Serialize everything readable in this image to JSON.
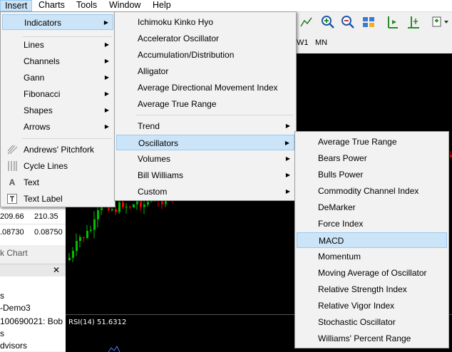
{
  "menubar": {
    "items": [
      "Insert",
      "Charts",
      "Tools",
      "Window",
      "Help"
    ]
  },
  "timeframes": [
    "W1",
    "MN"
  ],
  "quotes": [
    {
      "bid": "209.66",
      "ask": "210.35"
    },
    {
      "bid": ".08730",
      "ask": "0.08750"
    }
  ],
  "left_tab_label": "k Chart",
  "navigator": {
    "lines": [
      "s",
      "-Demo3",
      "100690021: Bob",
      "s",
      "dvisors"
    ]
  },
  "rsi_label": "RSI(14) 51.6312",
  "insert_menu": {
    "items": [
      {
        "label": "Indicators",
        "submenu": true,
        "highlight": true
      },
      {
        "label": "Lines",
        "submenu": true
      },
      {
        "label": "Channels",
        "submenu": true
      },
      {
        "label": "Gann",
        "submenu": true
      },
      {
        "label": "Fibonacci",
        "submenu": true
      },
      {
        "label": "Shapes",
        "submenu": true
      },
      {
        "label": "Arrows",
        "submenu": true
      },
      {
        "label": "Andrews' Pitchfork",
        "icon": "pitchfork-icon"
      },
      {
        "label": "Cycle Lines",
        "icon": "cycle-lines-icon"
      },
      {
        "label": "Text",
        "icon": "text-icon"
      },
      {
        "label": "Text Label",
        "icon": "text-label-icon"
      }
    ]
  },
  "indicators_menu": {
    "items": [
      {
        "label": "Ichimoku Kinko Hyo"
      },
      {
        "label": "Accelerator Oscillator"
      },
      {
        "label": "Accumulation/Distribution"
      },
      {
        "label": "Alligator"
      },
      {
        "label": "Average Directional Movement Index"
      },
      {
        "label": "Average True Range"
      },
      {
        "label": "Trend",
        "submenu": true
      },
      {
        "label": "Oscillators",
        "submenu": true,
        "highlight": true
      },
      {
        "label": "Volumes",
        "submenu": true
      },
      {
        "label": "Bill Williams",
        "submenu": true
      },
      {
        "label": "Custom",
        "submenu": true
      }
    ]
  },
  "oscillators_menu": {
    "items": [
      {
        "label": "Average True Range"
      },
      {
        "label": "Bears Power"
      },
      {
        "label": "Bulls Power"
      },
      {
        "label": "Commodity Channel Index"
      },
      {
        "label": "DeMarker"
      },
      {
        "label": "Force Index"
      },
      {
        "label": "MACD",
        "highlight": true
      },
      {
        "label": "Momentum"
      },
      {
        "label": "Moving Average of Oscillator"
      },
      {
        "label": "Relative Strength Index"
      },
      {
        "label": "Relative Vigor Index"
      },
      {
        "label": "Stochastic Oscillator"
      },
      {
        "label": "Williams' Percent Range"
      }
    ]
  },
  "colors": {
    "bull_candle": "#00c000",
    "bear_candle": "#ff0000",
    "menu_highlight": "#cce4f7"
  }
}
